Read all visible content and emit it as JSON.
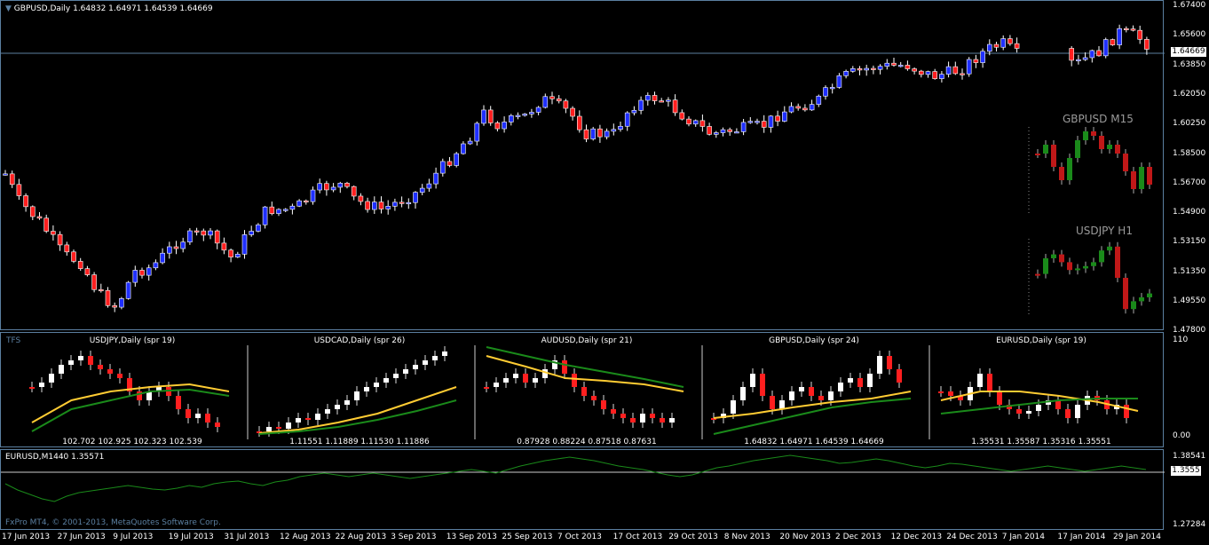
{
  "colors": {
    "bull": "#1f2fff",
    "bear": "#ff1f1f",
    "frame": "#5b7fa0",
    "wick": "#ffffff",
    "yellow": "#ffcc33",
    "green": "#1a8a1a",
    "line": "#1a8a1a"
  },
  "main": {
    "title": "GBPUSD,Daily  1.64832 1.64971 1.64539 1.64669",
    "price_box": "1.64669",
    "y_ticks": [
      "1.67400",
      "1.65600",
      "1.63850",
      "1.62050",
      "1.60250",
      "1.58500",
      "1.56700",
      "1.54900",
      "1.53150",
      "1.51350",
      "1.49550",
      "1.47800"
    ],
    "overlay_labels": [
      "GBPUSD M15",
      "USDJPY H1"
    ]
  },
  "tfs": {
    "label": "TFS",
    "y_ticks": [
      "110",
      "0.00"
    ],
    "panels": [
      {
        "title": "USDJPY,Daily (spr 19)",
        "footer": "102.702  102.925  102.323  102.539"
      },
      {
        "title": "USDCAD,Daily (spr 26)",
        "footer": "1.11551  1.11889  1.11530  1.11886"
      },
      {
        "title": "AUDUSD,Daily (spr 21)",
        "footer": "0.87928  0.88224  0.87518  0.87631"
      },
      {
        "title": "GBPUSD,Daily (spr 24)",
        "footer": "1.64832  1.64971  1.64539  1.64669"
      },
      {
        "title": "EURUSD,Daily (spr 19)",
        "footer": "1.35531  1.35587  1.35316  1.35551"
      }
    ]
  },
  "line_pane": {
    "title": "EURUSD,M1440 1.35571",
    "y_ticks": [
      "1.38541",
      "1.27284"
    ],
    "price_box": "1.3555",
    "copyright": "FxPro MT4, © 2001-2013, MetaQuotes Software Corp."
  },
  "x_axis": [
    "17 Jun 2013",
    "27 Jun 2013",
    "9 Jul 2013",
    "19 Jul 2013",
    "31 Jul 2013",
    "12 Aug 2013",
    "22 Aug 2013",
    "3 Sep 2013",
    "13 Sep 2013",
    "25 Sep 2013",
    "7 Oct 2013",
    "17 Oct 2013",
    "29 Oct 2013",
    "8 Nov 2013",
    "20 Nov 2013",
    "2 Dec 2013",
    "12 Dec 2013",
    "24 Dec 2013",
    "7 Jan 2014",
    "17 Jan 2014",
    "29 Jan 2014"
  ]
}
